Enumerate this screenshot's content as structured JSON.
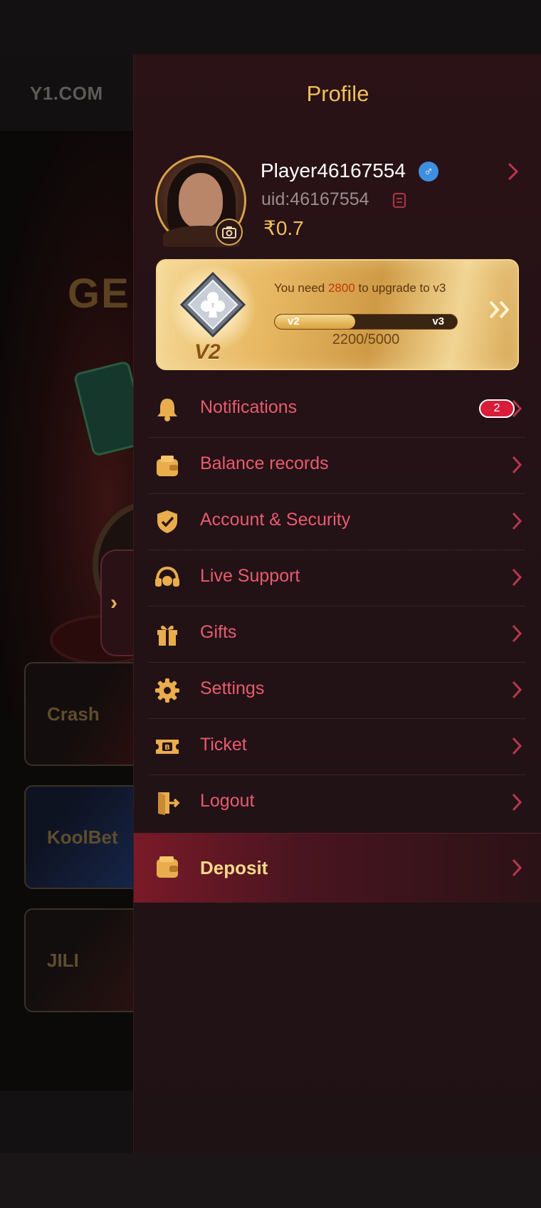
{
  "app": {
    "logo_text": "Y1.COM",
    "banner_text": "GE",
    "games": [
      {
        "label": "Crash"
      },
      {
        "label": "KoolBet"
      },
      {
        "label": "JILI"
      }
    ]
  },
  "drawer": {
    "title": "Profile",
    "user": {
      "name": "Player46167554",
      "gender_symbol": "♂",
      "uid": "uid:46167554",
      "balance": "₹0.7"
    },
    "vip": {
      "level": "V2",
      "need_prefix": "You need ",
      "need_amount": "2800",
      "need_suffix": " to upgrade to v3",
      "current_label": "v2",
      "next_label": "v3",
      "progress_text": "2200/5000",
      "progress_fraction": 0.44
    },
    "menu": [
      {
        "id": "notifications",
        "label": "Notifications",
        "icon": "bell-icon",
        "badge": "2"
      },
      {
        "id": "balance-records",
        "label": "Balance records",
        "icon": "wallet-icon"
      },
      {
        "id": "account-security",
        "label": "Account & Security",
        "icon": "shield-check-icon"
      },
      {
        "id": "live-support",
        "label": "Live Support",
        "icon": "headset-icon"
      },
      {
        "id": "gifts",
        "label": "Gifts",
        "icon": "gift-icon"
      },
      {
        "id": "settings",
        "label": "Settings",
        "icon": "gear-icon"
      },
      {
        "id": "ticket",
        "label": "Ticket",
        "icon": "ticket-icon"
      },
      {
        "id": "logout",
        "label": "Logout",
        "icon": "logout-icon"
      }
    ],
    "deposit": {
      "label": "Deposit",
      "icon": "wallet-icon"
    }
  },
  "colors": {
    "gold": "#f0c05a",
    "menu_text": "#e85b6e",
    "drawer_bg": "#231216",
    "badge_red": "#d81c3a"
  }
}
